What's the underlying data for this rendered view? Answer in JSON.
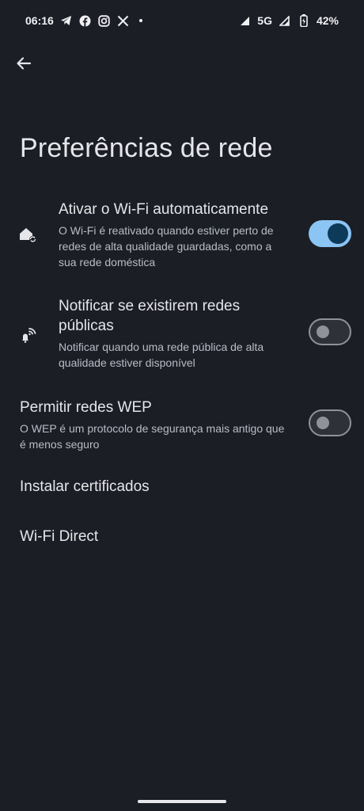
{
  "status_bar": {
    "time": "06:16",
    "network": "5G",
    "battery": "42%",
    "left_icons": [
      "telegram-icon",
      "facebook-icon",
      "instagram-icon",
      "x-icon"
    ],
    "right_icons": [
      "signal-icon",
      "signal-icon-2",
      "battery-icon"
    ]
  },
  "header": {
    "title": "Preferências de rede",
    "back_icon": "arrow-back-icon"
  },
  "settings": [
    {
      "id": "auto-wifi",
      "icon": "home-wifi-icon",
      "title": "Ativar o Wi-Fi automaticamente",
      "subtitle": "O Wi-Fi é reativado quando estiver perto de redes de alta qualidade guardadas, como a sua rede doméstica",
      "toggle": "on"
    },
    {
      "id": "public-networks",
      "icon": "wifi-bell-icon",
      "title": "Notificar se existirem redes públicas",
      "subtitle": "Notificar quando uma rede pública de alta qualidade estiver disponível",
      "toggle": "off"
    },
    {
      "id": "wep",
      "title": "Permitir redes WEP",
      "subtitle": "O WEP é um protocolo de segurança mais antigo que é menos seguro",
      "toggle": "off"
    }
  ],
  "links": {
    "install_certificates": "Instalar certificados",
    "wifi_direct": "Wi-Fi Direct"
  },
  "colors": {
    "background": "#1b1e25",
    "toggle_on_track": "#8cc4f3",
    "toggle_on_thumb": "#0d3a59",
    "toggle_off_outline": "#8f929a"
  }
}
